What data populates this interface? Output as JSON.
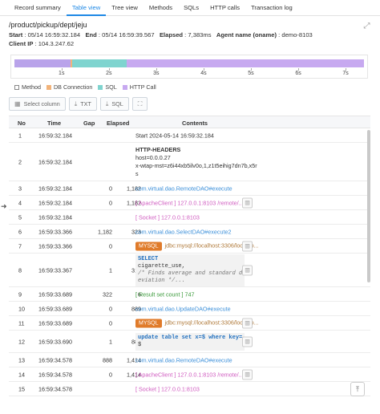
{
  "tabs": [
    "Record summary",
    "Table view",
    "Tree view",
    "Methods",
    "SQLs",
    "HTTP calls",
    "Transaction log"
  ],
  "page": {
    "title": "/product/pickup/dept/jeju",
    "start_label": "Start",
    "start": "05/14 16:59:32.184",
    "end_label": "End",
    "end": "05/14 16:59:39.567",
    "elapsed_label": "Elapsed",
    "elapsed": "7,383ms",
    "agent_label": "Agent name (oname)",
    "agent": "demo-8103",
    "client_ip_label": "Client IP",
    "client_ip": "104.3.247.62"
  },
  "timeline": {
    "ticks": [
      "1s",
      "2s",
      "3s",
      "4s",
      "5s",
      "6s",
      "7s"
    ],
    "colors": {
      "method": "#b59be6",
      "db": "#f2b37a",
      "sql": "#7fd4cf",
      "http": "#c7a9f0"
    }
  },
  "legend": [
    "Method",
    "DB Connection",
    "SQL",
    "HTTP Call"
  ],
  "toolbar": {
    "select_column": "Select column",
    "txt": "TXT",
    "sql": "SQL"
  },
  "columns": [
    "No",
    "Time",
    "Gap",
    "Elapsed",
    "Contents"
  ],
  "rows": [
    {
      "no": "1",
      "time": "16:59:32.184",
      "gap": "",
      "elapsed": "",
      "content": "Start   2024-05-14 16:59:32.184"
    },
    {
      "no": "2",
      "time": "16:59:32.184",
      "gap": "",
      "elapsed": "",
      "content": "HTTP-HEADERS",
      "lines": [
        "host=0.0.0.27",
        "x-wtap-mst=z6i44xb5ilv0o,1,z1t5eihig7dn7b,x5r",
        "s"
      ]
    },
    {
      "no": "3",
      "time": "16:59:32.184",
      "gap": "0",
      "elapsed": "1,182",
      "content": "com.virtual.dao.RemoteDAO#execute"
    },
    {
      "no": "4",
      "time": "16:59:32.184",
      "gap": "0",
      "elapsed": "1,182",
      "content": "[ ApacheClient ] 127.0.0.1:8103 /remote/..."
    },
    {
      "no": "5",
      "time": "16:59:32.184",
      "gap": "",
      "elapsed": "",
      "content": "[ Socket ] 127.0.0.1:8103"
    },
    {
      "no": "6",
      "time": "16:59:33.366",
      "gap": "1,182",
      "elapsed": "323",
      "content": "com.virtual.dao.SelectDAO#execute2"
    },
    {
      "no": "7",
      "time": "16:59:33.366",
      "gap": "0",
      "elapsed": "1",
      "badge": "MYSQL",
      "content": "jdbc:mysql://localhost:3306/localho..."
    },
    {
      "no": "8",
      "time": "16:59:33.367",
      "gap": "1",
      "elapsed": "316",
      "sql": [
        "SELECT",
        "cigarette_use,",
        "/* Finds average and standard d",
        "eviation */..."
      ]
    },
    {
      "no": "9",
      "time": "16:59:33.689",
      "gap": "322",
      "elapsed": "6",
      "content": "[ Result set count ] 747"
    },
    {
      "no": "10",
      "time": "16:59:33.689",
      "gap": "0",
      "elapsed": "889",
      "content": "com.virtual.dao.UpdateDAO#execute"
    },
    {
      "no": "11",
      "time": "16:59:33.689",
      "gap": "0",
      "elapsed": "1",
      "badge": "MYSQL",
      "content": "jdbc:mysql://localhost:3306/localho..."
    },
    {
      "no": "12",
      "time": "16:59:33.690",
      "gap": "1",
      "elapsed": "888",
      "sql": [
        "update table set x=$ where key=",
        "$"
      ]
    },
    {
      "no": "13",
      "time": "16:59:34.578",
      "gap": "888",
      "elapsed": "1,414",
      "content": "com.virtual.dao.RemoteDAO#execute"
    },
    {
      "no": "14",
      "time": "16:59:34.578",
      "gap": "0",
      "elapsed": "1,414",
      "content": "[ ApacheClient ] 127.0.0.1:8103 /remote/..."
    },
    {
      "no": "15",
      "time": "16:59:34.578",
      "gap": "",
      "elapsed": "",
      "content": "[ Socket ] 127.0.0.1:8103"
    }
  ]
}
